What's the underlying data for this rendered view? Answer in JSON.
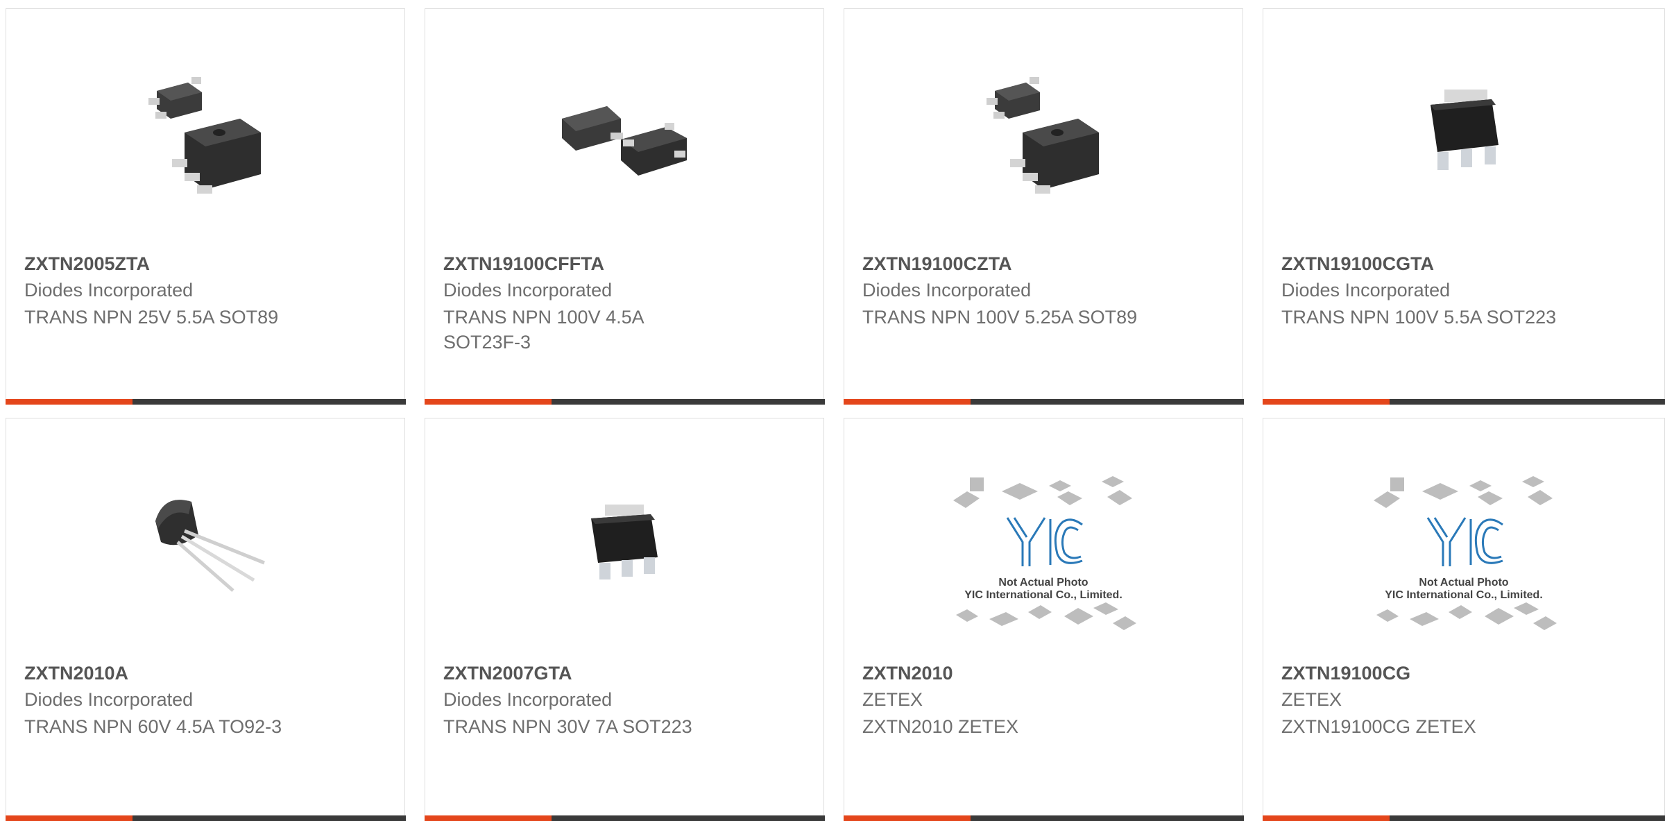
{
  "products": [
    {
      "part": "ZXTN2005ZTA",
      "manufacturer": "Diodes Incorporated",
      "description": "TRANS NPN 25V 5.5A SOT89",
      "image": "sot89-package-photo"
    },
    {
      "part": "ZXTN19100CFFTA",
      "manufacturer": "Diodes Incorporated",
      "description": "TRANS NPN 100V 4.5A SOT23F-3",
      "image": "sot23f-package-photo"
    },
    {
      "part": "ZXTN19100CZTA",
      "manufacturer": "Diodes Incorporated",
      "description": "TRANS NPN 100V 5.25A SOT89",
      "image": "sot89-package-photo"
    },
    {
      "part": "ZXTN19100CGTA",
      "manufacturer": "Diodes Incorporated",
      "description": "TRANS NPN 100V 5.5A SOT223",
      "image": "sot223-package-photo"
    },
    {
      "part": "ZXTN2010A",
      "manufacturer": "Diodes Incorporated",
      "description": "TRANS NPN 60V 4.5A TO92-3",
      "image": "to92-package-photo"
    },
    {
      "part": "ZXTN2007GTA",
      "manufacturer": "Diodes Incorporated",
      "description": "TRANS NPN 30V 7A SOT223",
      "image": "sot223-package-photo"
    },
    {
      "part": "ZXTN2010",
      "manufacturer": "ZETEX",
      "description": "ZXTN2010 ZETEX",
      "image": "placeholder-photo",
      "placeholder_text": [
        "Not Actual Photo",
        "YIC International Co., Limited."
      ],
      "placeholder_logo": "YIC"
    },
    {
      "part": "ZXTN19100CG",
      "manufacturer": "ZETEX",
      "description": "ZXTN19100CG ZETEX",
      "image": "placeholder-photo",
      "placeholder_text": [
        "Not Actual Photo",
        "YIC International Co., Limited."
      ],
      "placeholder_logo": "YIC"
    }
  ],
  "colors": {
    "accent": "#e4461b",
    "bar": "#3a3a3a",
    "border": "#dedede",
    "part_text": "#555555",
    "body_text": "#6e6e6e",
    "logo_blue": "#2a79b8"
  }
}
